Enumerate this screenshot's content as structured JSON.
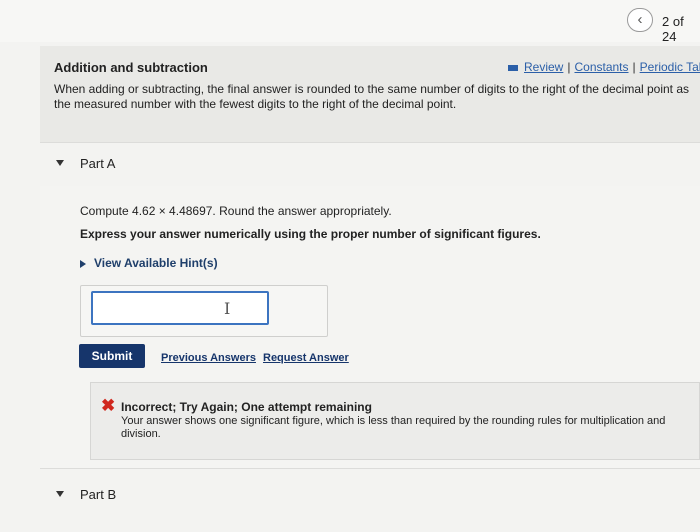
{
  "topbar": {
    "page_count": "2 of 24"
  },
  "intro": {
    "title": "Addition and subtraction",
    "links": [
      "Review",
      "Constants",
      "Periodic Tab"
    ],
    "text": "When adding or subtracting, the final answer is rounded to the same number of digits to the right of the decimal point as the measured number with the fewest digits to the right of the decimal point."
  },
  "part_a": {
    "label": "Part A",
    "question": "Compute 4.62 × 4.48697. Round the answer appropriately.",
    "instruction": "Express your answer numerically using the proper number of significant figures.",
    "hint_label": "View Available Hint(s)",
    "answer_value": "",
    "submit_label": "Submit",
    "previous_answers_label": "Previous Answers",
    "request_answer_label": "Request Answer",
    "feedback": {
      "title": "Incorrect; Try Again; One attempt remaining",
      "text": "Your answer shows one significant figure, which is less than required by the rounding rules for multiplication and division."
    }
  },
  "part_b": {
    "label": "Part B"
  },
  "colors": {
    "accent": "#16356b",
    "link": "#2b5fa8",
    "error": "#d0281e",
    "input_border": "#3c74c0"
  }
}
